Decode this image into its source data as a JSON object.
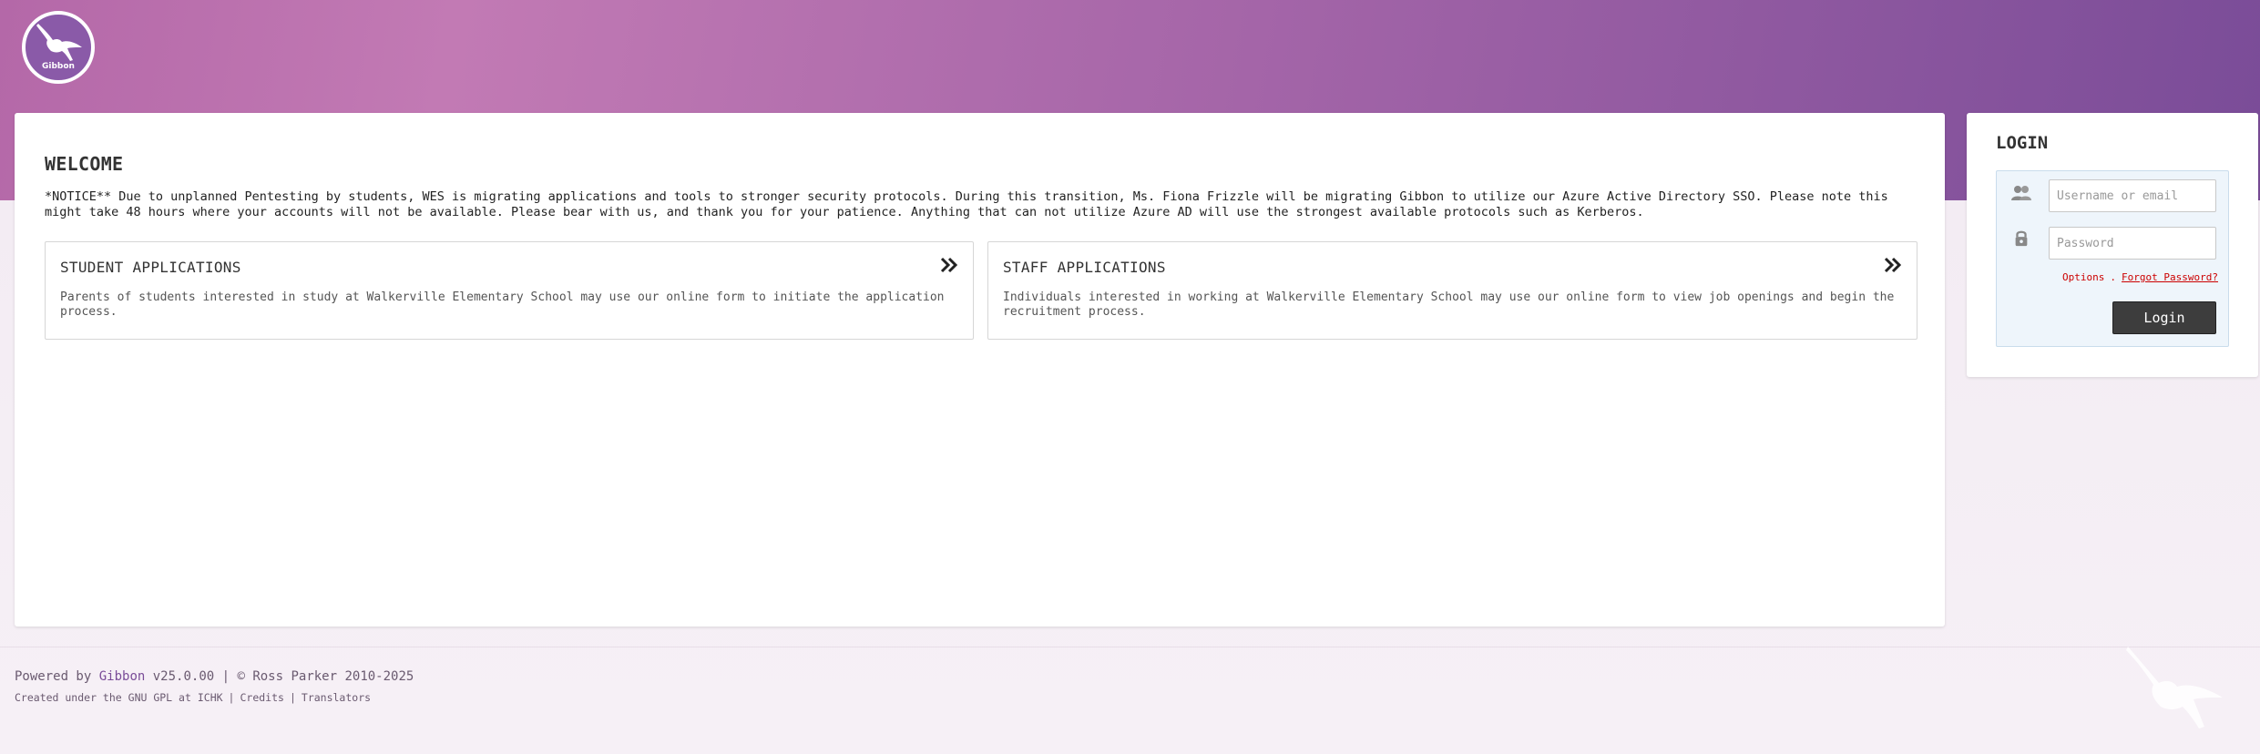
{
  "brand": {
    "logo_text": "Gibbon",
    "colors": {
      "header_start": "#b468a8",
      "header_end": "#7a4c98",
      "accent": "#7a4c98",
      "link_red": "#cc0000",
      "button_dark": "#3d3d3d"
    }
  },
  "welcome": {
    "title": "WELCOME",
    "notice": "*NOTICE** Due to unplanned Pentesting by students, WES is migrating applications and tools to stronger security protocols. During this transition, Ms. Fiona Frizzle will be migrating Gibbon to utilize our Azure Active Directory SSO. Please note this might take 48 hours where your accounts will not be available. Please bear with us, and thank you for your patience. Anything that can not utilize Azure AD will use the strongest available protocols such as Kerberos."
  },
  "applications": [
    {
      "title": "STUDENT APPLICATIONS",
      "description": "Parents of students interested in study at Walkerville Elementary School may use our online form to initiate the application process.",
      "icon": "double-chevron-right-icon"
    },
    {
      "title": "STAFF APPLICATIONS",
      "description": "Individuals interested in working at Walkerville Elementary School may use our online form to view job openings and begin the recruitment process.",
      "icon": "double-chevron-right-icon"
    }
  ],
  "login": {
    "title": "LOGIN",
    "username_placeholder": "Username or email",
    "username_value": "",
    "password_placeholder": "Password",
    "password_value": "",
    "username_icon": "users-icon",
    "password_icon": "lock-icon",
    "options_label": "Options",
    "options_separator": ".",
    "forgot_label": "Forgot Password?",
    "button_label": "Login"
  },
  "footer": {
    "powered_prefix": "Powered by",
    "powered_link": "Gibbon",
    "powered_suffix": "v25.0.00 | © Ross Parker 2010-2025",
    "created_prefix": "Created under the",
    "gpl_link": "GNU GPL",
    "at_text": "at",
    "ichk_link": "ICHK",
    "separator": "|",
    "credits_link": "Credits",
    "translators_link": "Translators"
  }
}
